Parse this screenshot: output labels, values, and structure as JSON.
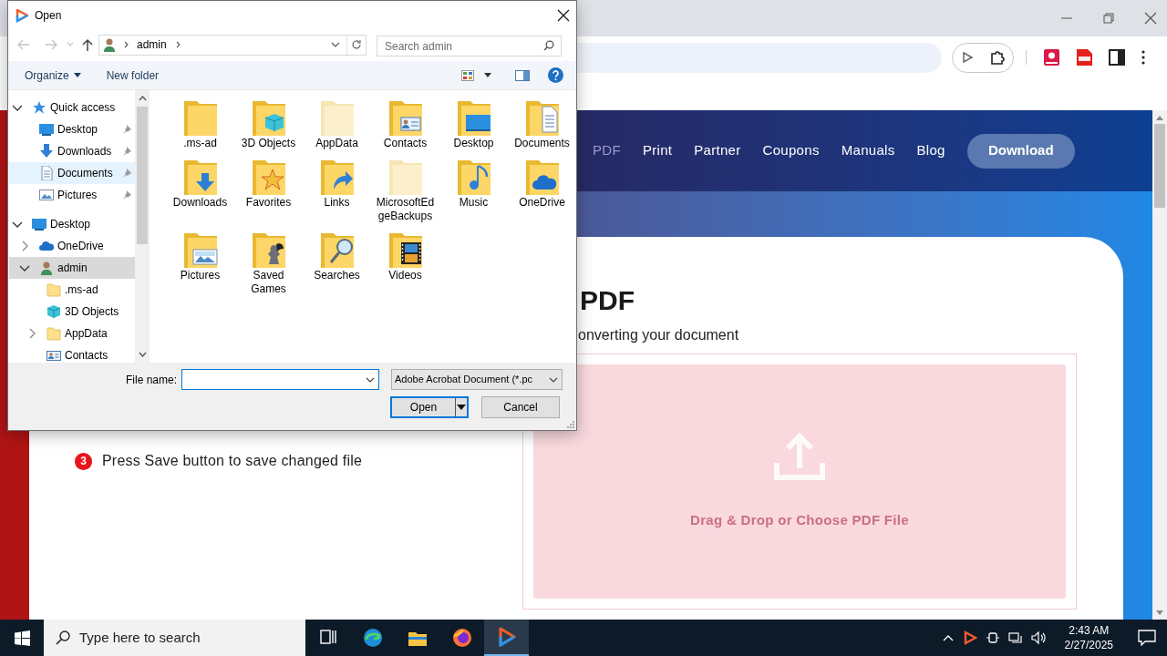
{
  "browser": {
    "nav_links": [
      {
        "label": "PDF",
        "dimmed": true
      },
      {
        "label": "Print",
        "dimmed": false
      },
      {
        "label": "Partner",
        "dimmed": false
      },
      {
        "label": "Coupons",
        "dimmed": false
      },
      {
        "label": "Manuals",
        "dimmed": false
      },
      {
        "label": "Blog",
        "dimmed": false
      }
    ],
    "download_button": "Download",
    "heading": "PDF",
    "subtitle": "onverting your document",
    "steps": [
      {
        "number": "3",
        "text": "Press Save button to save changed file"
      }
    ],
    "dropzone_label": "Drag & Drop or Choose PDF File"
  },
  "dialog": {
    "title": "Open",
    "breadcrumb": [
      "admin"
    ],
    "search_placeholder": "Search admin",
    "toolbar": [
      "Organize",
      "New folder"
    ],
    "tree": [
      {
        "label": "Quick access",
        "kind": "star",
        "expanded": true,
        "selected": false,
        "hovered": false,
        "children": [
          {
            "label": "Desktop",
            "kind": "desktop",
            "pinned": true,
            "selected": false,
            "hovered": false
          },
          {
            "label": "Downloads",
            "kind": "downloads",
            "pinned": true,
            "selected": false,
            "hovered": false
          },
          {
            "label": "Documents",
            "kind": "documents",
            "pinned": true,
            "selected": false,
            "hovered": true
          },
          {
            "label": "Pictures",
            "kind": "pictures",
            "pinned": true,
            "selected": false,
            "hovered": false
          }
        ]
      },
      {
        "label": "Desktop",
        "kind": "desktop",
        "expanded": true,
        "selected": false,
        "hovered": false,
        "children": [
          {
            "label": "OneDrive",
            "kind": "cloud",
            "expanded": false,
            "selected": false,
            "hovered": false
          },
          {
            "label": "admin",
            "kind": "user",
            "expanded": true,
            "selected": true,
            "hovered": false,
            "children": [
              {
                "label": ".ms-ad",
                "kind": "folder",
                "selected": false,
                "hovered": false
              },
              {
                "label": "3D Objects",
                "kind": "cube",
                "selected": false,
                "hovered": false
              },
              {
                "label": "AppData",
                "kind": "folder",
                "expanded": false,
                "selected": false,
                "hovered": false
              },
              {
                "label": "Contacts",
                "kind": "contacts",
                "selected": false,
                "hovered": false
              }
            ]
          }
        ]
      }
    ],
    "folders": [
      {
        "label": ".ms-ad",
        "kind": "plain",
        "hidden": false
      },
      {
        "label": "3D Objects",
        "kind": "cube",
        "hidden": false
      },
      {
        "label": "AppData",
        "kind": "plain",
        "hidden": true
      },
      {
        "label": "Contacts",
        "kind": "contacts",
        "hidden": false
      },
      {
        "label": "Desktop",
        "kind": "desktop",
        "hidden": false
      },
      {
        "label": "Documents",
        "kind": "documents",
        "hidden": false
      },
      {
        "label": "Downloads",
        "kind": "downloads",
        "hidden": false
      },
      {
        "label": "Favorites",
        "kind": "star",
        "hidden": false
      },
      {
        "label": "Links",
        "kind": "link",
        "hidden": false
      },
      {
        "label": "MicrosoftEdgeBackups",
        "kind": "plain",
        "hidden": true
      },
      {
        "label": "Music",
        "kind": "music",
        "hidden": false
      },
      {
        "label": "OneDrive",
        "kind": "cloud",
        "hidden": false
      },
      {
        "label": "Pictures",
        "kind": "pictures",
        "hidden": false
      },
      {
        "label": "Saved Games",
        "kind": "game",
        "hidden": false
      },
      {
        "label": "Searches",
        "kind": "search",
        "hidden": false
      },
      {
        "label": "Videos",
        "kind": "video",
        "hidden": false
      }
    ],
    "file_name_label": "File name:",
    "filter": "Adobe Acrobat Document (*.pc",
    "buttons": [
      "Open",
      "Cancel"
    ]
  },
  "taskbar": {
    "search_placeholder": "Type here to search",
    "apps": [
      {
        "kind": "taskview",
        "active": false
      },
      {
        "kind": "edge",
        "active": false
      },
      {
        "kind": "explorer",
        "active": false
      },
      {
        "kind": "firefox",
        "active": false
      },
      {
        "kind": "player",
        "active": true
      }
    ],
    "time": "2:43 AM",
    "date": "2/27/2025"
  }
}
